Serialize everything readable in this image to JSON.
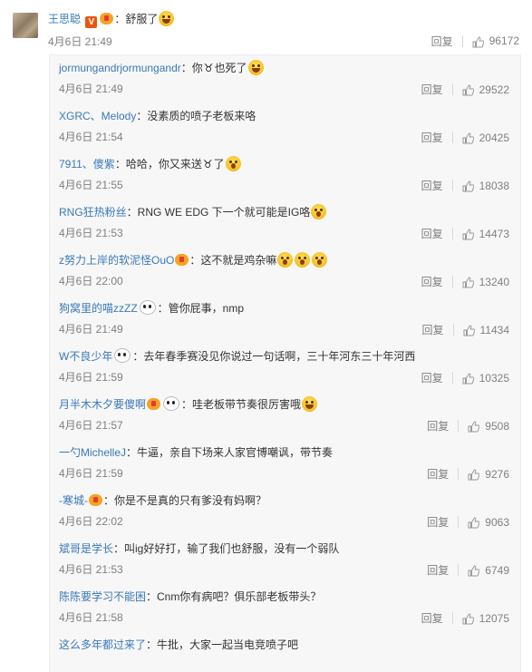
{
  "main_comment": {
    "username": "王思聪",
    "text": "：舒服了",
    "time": "4月6日 21:49",
    "reply_label": "回复",
    "likes": "96172"
  },
  "replies": [
    {
      "username": "jormungandrjormungandr",
      "text_before": "：你",
      "text_mid": "也死了",
      "time": "4月6日 21:49",
      "reply_label": "回复",
      "likes": "29522",
      "emoji": "laugh",
      "ox": true
    },
    {
      "username": "XGRC、Melody",
      "text": "：没素质的喷子老板来咯",
      "time": "4月6日 21:54",
      "reply_label": "回复",
      "likes": "20425"
    },
    {
      "username": "7911、傻紫",
      "text_before": "：哈哈，你又来送",
      "text_mid": "了",
      "time": "4月6日 21:55",
      "reply_label": "回复",
      "likes": "18038",
      "emoji": "surprise",
      "ox": true
    },
    {
      "username": "RNG狂热粉丝",
      "text": "：RNG WE EDG 下一个就可能是IG咯",
      "time": "4月6日 21:53",
      "reply_label": "回复",
      "likes": "14473",
      "emoji": "surprise"
    },
    {
      "username": "z努力上岸的软泥怪OuO",
      "text": "：这不就是鸡杂嘛",
      "time": "4月6日 22:00",
      "reply_label": "回复",
      "likes": "13240",
      "emoji_count": 3
    },
    {
      "username": "狗窝里的喵zzZZ",
      "text": "：管你屁事，nmp",
      "time": "4月6日 21:49",
      "reply_label": "回复",
      "likes": "11434",
      "panda": true
    },
    {
      "username": "W不良少年",
      "text": "：去年春季赛没见你说过一句话啊，三十年河东三十年河西",
      "time": "4月6日 21:59",
      "reply_label": "回复",
      "likes": "10325",
      "panda": true
    },
    {
      "username": "月半木木夕要傻啊",
      "text": "：哇老板带节奏很厉害哦",
      "time": "4月6日 21:57",
      "reply_label": "回复",
      "likes": "9508",
      "medal": true,
      "panda": true,
      "emoji": "laugh"
    },
    {
      "username": "一勺MichelleJ",
      "text": "：牛逼，亲自下场来人家官博嘲讽，带节奏",
      "time": "4月6日 21:59",
      "reply_label": "回复",
      "likes": "9276"
    },
    {
      "username": "-寒城-",
      "text": "：你是不是真的只有爹没有妈啊？",
      "time": "4月6日 22:02",
      "reply_label": "回复",
      "likes": "9063",
      "medal": true
    },
    {
      "username": "斌哥是学长",
      "text": "：叫ig好好打，输了我们也舒服，没有一个弱队",
      "time": "4月6日 21:53",
      "reply_label": "回复",
      "likes": "6749"
    },
    {
      "username": "陈陈要学习不能困",
      "text": "：Cnm你有病吧？俱乐部老板带头？",
      "time": "4月6日 21:58",
      "reply_label": "回复",
      "likes": "12075"
    }
  ],
  "clipped_bottom": {
    "username": "这么多年都过来了",
    "text": "：牛批，大家一起当电竞喷子吧"
  },
  "colors": {
    "username": "#3a79b8",
    "meta": "#808080",
    "reply_bg": "#f7f7f7",
    "vip": "#e8560f"
  },
  "icons": {
    "like": "thumb-up-icon",
    "laugh": "laugh-emoji-icon",
    "surprise": "surprise-emoji-icon",
    "panda": "panda-icon",
    "medal": "medal-icon",
    "ox": "ox-icon"
  }
}
